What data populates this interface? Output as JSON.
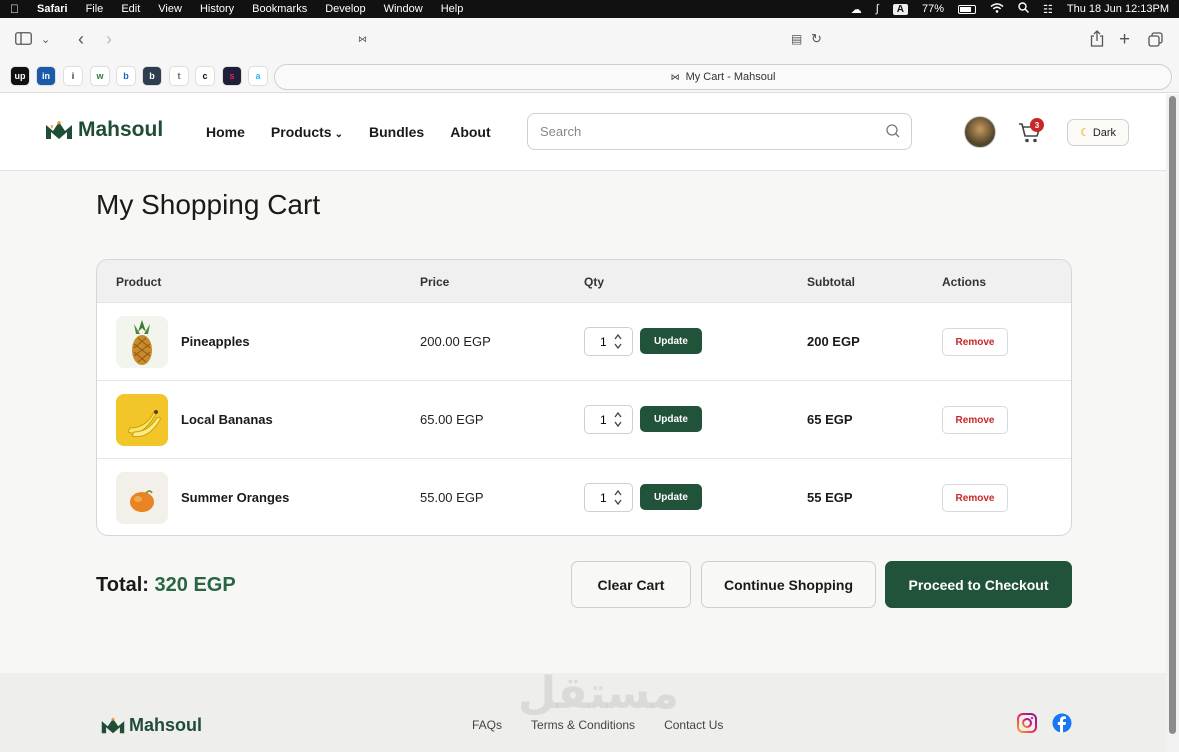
{
  "menubar": {
    "app_name": "Safari",
    "items": [
      "File",
      "Edit",
      "View",
      "History",
      "Bookmarks",
      "Develop",
      "Window",
      "Help"
    ],
    "input_indicator": "A",
    "battery": "77%",
    "datetime": "Thu 18 Jun  12:13PM"
  },
  "browser": {
    "tab_title": "My Cart - Mahsoul",
    "favorites": [
      "up",
      "in",
      "i",
      "w",
      "b",
      "b",
      "t",
      "c",
      "s",
      "a"
    ]
  },
  "site": {
    "logo_text": "Mahsoul",
    "nav": {
      "home": "Home",
      "products": "Products",
      "bundles": "Bundles",
      "about": "About"
    },
    "search_placeholder": "Search",
    "cart_count": "3",
    "theme_toggle": "Dark",
    "brand_color": "#21523a"
  },
  "cart": {
    "title": "My Shopping Cart",
    "columns": {
      "product": "Product",
      "price": "Price",
      "qty": "Qty",
      "subtotal": "Subtotal",
      "actions": "Actions"
    },
    "items": [
      {
        "name": "Pineapples",
        "price": "200.00 EGP",
        "qty": "1",
        "subtotal": "200 EGP",
        "thumb": "pineapple"
      },
      {
        "name": "Local Bananas",
        "price": "65.00 EGP",
        "qty": "1",
        "subtotal": "65 EGP",
        "thumb": "banana"
      },
      {
        "name": "Summer Oranges",
        "price": "55.00 EGP",
        "qty": "1",
        "subtotal": "55 EGP",
        "thumb": "orange"
      }
    ],
    "update_label": "Update",
    "remove_label": "Remove",
    "total_label": "Total:",
    "total_value": "320 EGP",
    "clear_label": "Clear Cart",
    "continue_label": "Continue Shopping",
    "checkout_label": "Proceed to Checkout"
  },
  "footer": {
    "logo_text": "Mahsoul",
    "links": {
      "faqs": "FAQs",
      "terms": "Terms & Conditions",
      "contact": "Contact Us"
    },
    "social": [
      "instagram-icon",
      "facebook-icon"
    ]
  },
  "watermark": "مستقل"
}
